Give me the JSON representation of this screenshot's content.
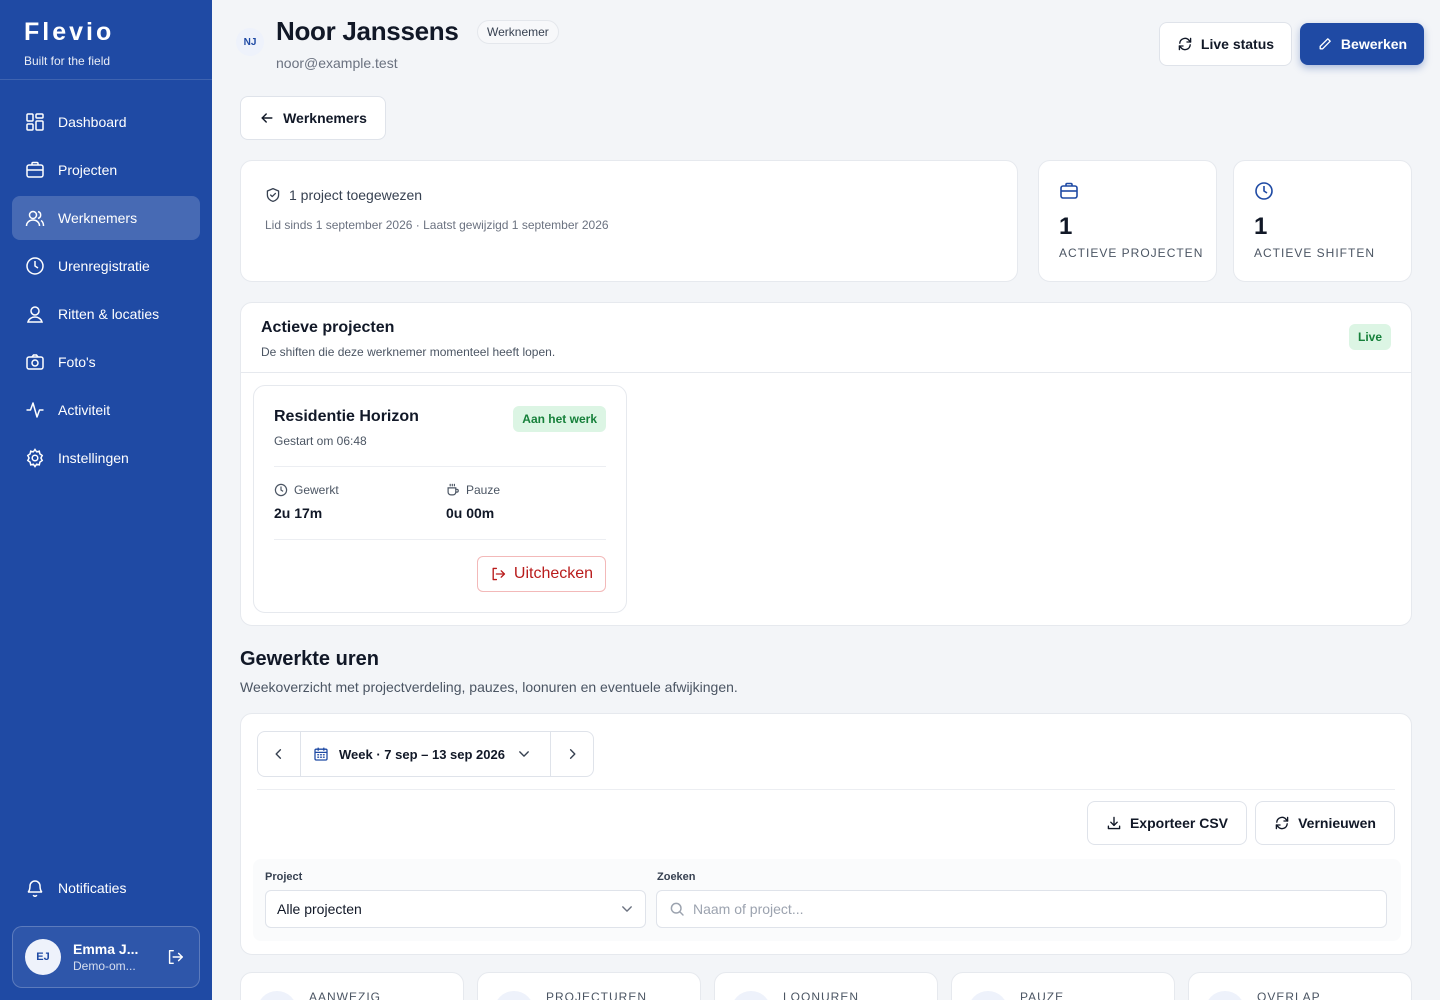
{
  "brand": {
    "name": "Flevio",
    "tagline": "Built for the field"
  },
  "nav": [
    {
      "label": "Dashboard",
      "icon": "dashboard-icon"
    },
    {
      "label": "Projecten",
      "icon": "briefcase-icon"
    },
    {
      "label": "Werknemers",
      "icon": "users-icon",
      "active": true
    },
    {
      "label": "Urenregistratie",
      "icon": "clock-icon"
    },
    {
      "label": "Ritten & locaties",
      "icon": "map-pin-icon"
    },
    {
      "label": "Foto's",
      "icon": "camera-icon"
    },
    {
      "label": "Activiteit",
      "icon": "activity-icon"
    },
    {
      "label": "Instellingen",
      "icon": "gear-icon"
    }
  ],
  "notifications": {
    "label": "Notificaties",
    "icon": "bell-icon"
  },
  "user": {
    "initials": "EJ",
    "name": "Emma J...",
    "org": "Demo-om..."
  },
  "employee": {
    "initials": "NJ",
    "name": "Noor Janssens",
    "role": "Werknemer",
    "email": "noor@example.test"
  },
  "actions": {
    "live_status": "Live status",
    "edit": "Bewerken",
    "back": "Werknemers"
  },
  "summary": {
    "assigned": "1 project toegewezen",
    "meta": "Lid sinds 1 september 2026 · Laatst gewijzigd 1 september 2026"
  },
  "stats": [
    {
      "value": "1",
      "label": "ACTIEVE PROJECTEN",
      "icon": "briefcase-icon"
    },
    {
      "value": "1",
      "label": "ACTIEVE SHIFTEN",
      "icon": "clock-icon"
    }
  ],
  "active_projects": {
    "title": "Actieve projecten",
    "subtitle": "De shiften die deze werknemer momenteel heeft lopen.",
    "badge": "Live",
    "items": [
      {
        "name": "Residentie Horizon",
        "started": "Gestart om 06:48",
        "status": "Aan het werk",
        "worked_label": "Gewerkt",
        "worked_value": "2u 17m",
        "pause_label": "Pauze",
        "pause_value": "0u 00m",
        "checkout": "Uitchecken"
      }
    ]
  },
  "hours": {
    "title": "Gewerkte uren",
    "subtitle": "Weekoverzicht met projectverdeling, pauzes, loonuren en eventuele afwijkingen.",
    "week": "Week · 7 sep – 13 sep 2026",
    "export": "Exporteer CSV",
    "refresh": "Vernieuwen",
    "project_label": "Project",
    "project_value": "Alle projecten",
    "search_label": "Zoeken",
    "search_placeholder": "Naam of project..."
  },
  "summary_cards": [
    "AANWEZIG",
    "PROJECTUREN",
    "LOONUREN",
    "PAUZE",
    "OVERLAP"
  ],
  "colors": {
    "brand": "#1f4aa4",
    "success_bg": "#dcf5e4",
    "success_text": "#16803a",
    "danger": "#b91c1c"
  }
}
